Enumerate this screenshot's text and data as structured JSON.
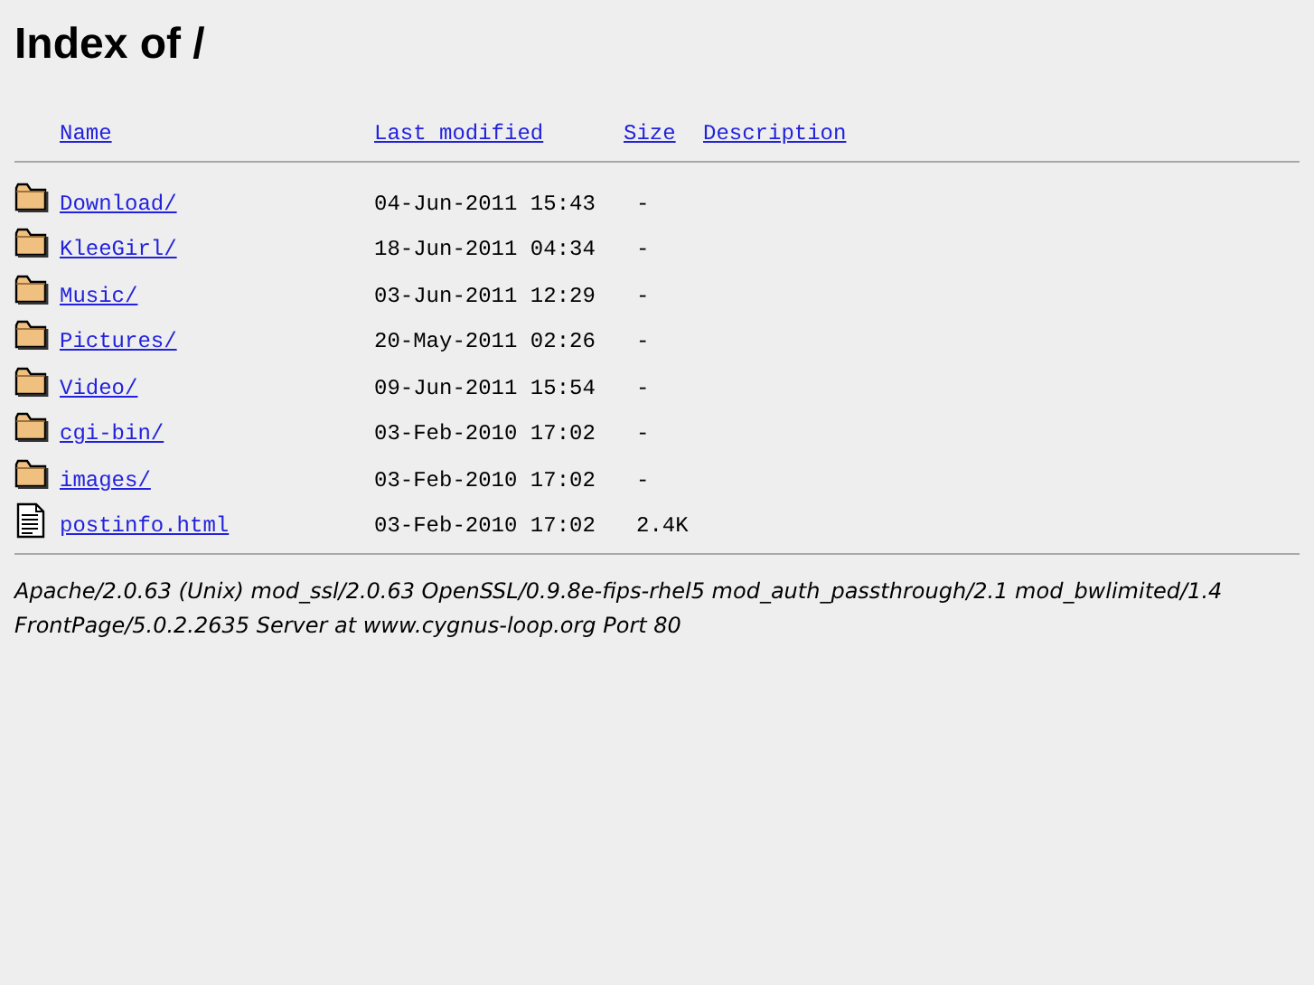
{
  "title": "Index of /",
  "columns": [
    "Name",
    "Last modified",
    "Size",
    "Description"
  ],
  "rows": [
    {
      "kind": "folder",
      "name": "Download/",
      "modified": "04-Jun-2011 15:43",
      "size": "-"
    },
    {
      "kind": "folder",
      "name": "KleeGirl/",
      "modified": "18-Jun-2011 04:34",
      "size": "-"
    },
    {
      "kind": "folder",
      "name": "Music/",
      "modified": "03-Jun-2011 12:29",
      "size": "-"
    },
    {
      "kind": "folder",
      "name": "Pictures/",
      "modified": "20-May-2011 02:26",
      "size": "-"
    },
    {
      "kind": "folder",
      "name": "Video/",
      "modified": "09-Jun-2011 15:54",
      "size": "-"
    },
    {
      "kind": "folder",
      "name": "cgi-bin/",
      "modified": "03-Feb-2010 17:02",
      "size": "-"
    },
    {
      "kind": "folder",
      "name": "images/",
      "modified": "03-Feb-2010 17:02",
      "size": "-"
    },
    {
      "kind": "file",
      "name": "postinfo.html",
      "modified": "03-Feb-2010 17:02",
      "size": "2.4K"
    }
  ],
  "address": "Apache/2.0.63 (Unix) mod_ssl/2.0.63 OpenSSL/0.9.8e-fips-rhel5 mod_auth_passthrough/2.1 mod_bwlimited/1.4 FrontPage/5.0.2.2635 Server at www.cygnus-loop.org Port 80"
}
